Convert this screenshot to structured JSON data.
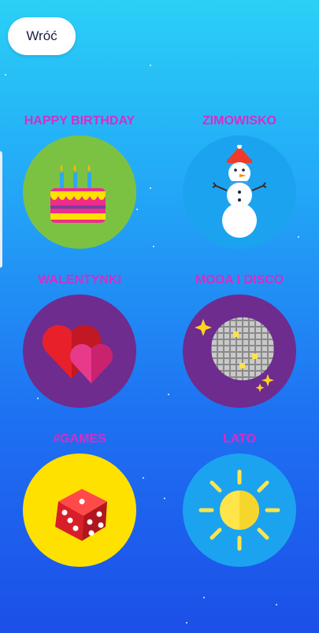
{
  "header": {
    "back_label": "Wróć"
  },
  "categories": [
    {
      "label": "HAPPY BIRTHDAY",
      "icon": "birthday-cake-icon",
      "color": "#7cc242"
    },
    {
      "label": "ZIMOWISKO",
      "icon": "snowman-icon",
      "color": "#1ba3f0"
    },
    {
      "label": "WALENTYNKI",
      "icon": "hearts-icon",
      "color": "#6d2c8e"
    },
    {
      "label": "MODA I DISCO",
      "icon": "disco-ball-icon",
      "color": "#6d2c8e"
    },
    {
      "label": "#GAMES",
      "icon": "dice-icon",
      "color": "#ffe100"
    },
    {
      "label": "LATO",
      "icon": "sun-icon",
      "color": "#1ba3f0"
    }
  ],
  "colors": {
    "label": "#d42ec6",
    "background_top": "#2ad0f6",
    "background_bottom": "#1c4fe8"
  }
}
